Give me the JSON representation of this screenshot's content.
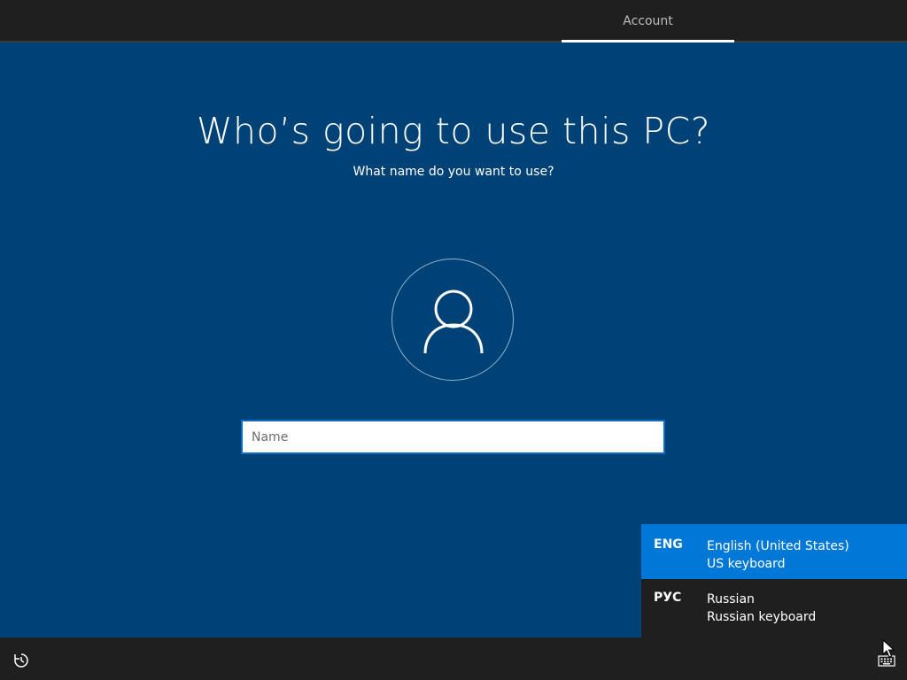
{
  "header": {
    "tabs": [
      {
        "label": "Account",
        "active": true
      }
    ]
  },
  "main": {
    "title": "Who’s going to use this PC?",
    "subtitle": "What name do you want to use?",
    "avatar_icon": "user-icon",
    "name_input": {
      "value": "",
      "placeholder": "Name"
    }
  },
  "language_flyout": {
    "items": [
      {
        "code": "ENG",
        "language": "English (United States)",
        "keyboard": "US keyboard",
        "selected": true
      },
      {
        "code": "РУС",
        "language": "Russian",
        "keyboard": "Russian keyboard",
        "selected": false
      }
    ]
  },
  "bottom_bar": {
    "left_icon": "ease-of-access-icon",
    "right_icon": "keyboard-icon"
  },
  "colors": {
    "background": "#004275",
    "bar": "#1f1f1f",
    "accent": "#0078d7",
    "input_border": "#0c6cc4"
  }
}
